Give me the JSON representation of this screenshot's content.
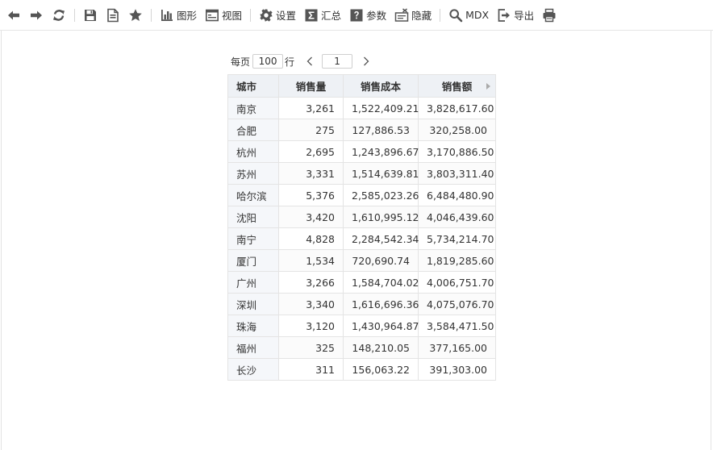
{
  "toolbar": {
    "chart_label": "图形",
    "view_label": "视图",
    "settings_label": "设置",
    "summary_label": "汇总",
    "params_label": "参数",
    "hide_label": "隐藏",
    "mdx_label": "MDX",
    "export_label": "导出"
  },
  "pager": {
    "per_page_label": "每页",
    "page_size": "100",
    "rows_label": "行",
    "current_page": "1"
  },
  "table": {
    "headers": [
      "城市",
      "销售量",
      "销售成本",
      "销售额"
    ],
    "rows": [
      [
        "南京",
        "3,261",
        "1,522,409.21",
        "3,828,617.60"
      ],
      [
        "合肥",
        "275",
        "127,886.53",
        "320,258.00"
      ],
      [
        "杭州",
        "2,695",
        "1,243,896.67",
        "3,170,886.50"
      ],
      [
        "苏州",
        "3,331",
        "1,514,639.81",
        "3,803,311.40"
      ],
      [
        "哈尔滨",
        "5,376",
        "2,585,023.26",
        "6,484,480.90"
      ],
      [
        "沈阳",
        "3,420",
        "1,610,995.12",
        "4,046,439.60"
      ],
      [
        "南宁",
        "4,828",
        "2,284,542.34",
        "5,734,214.70"
      ],
      [
        "厦门",
        "1,534",
        "720,690.74",
        "1,819,285.60"
      ],
      [
        "广州",
        "3,266",
        "1,584,704.02",
        "4,006,751.70"
      ],
      [
        "深圳",
        "3,340",
        "1,616,696.36",
        "4,075,076.70"
      ],
      [
        "珠海",
        "3,120",
        "1,430,964.87",
        "3,584,471.50"
      ],
      [
        "福州",
        "325",
        "148,210.05",
        "377,165.00"
      ],
      [
        "长沙",
        "311",
        "156,063.22",
        "391,303.00"
      ]
    ]
  },
  "colors": {
    "icon": "#555555",
    "header_bg": "#eef1f5",
    "city_bg": "#f5f7fa",
    "border": "#e4e4e4"
  }
}
